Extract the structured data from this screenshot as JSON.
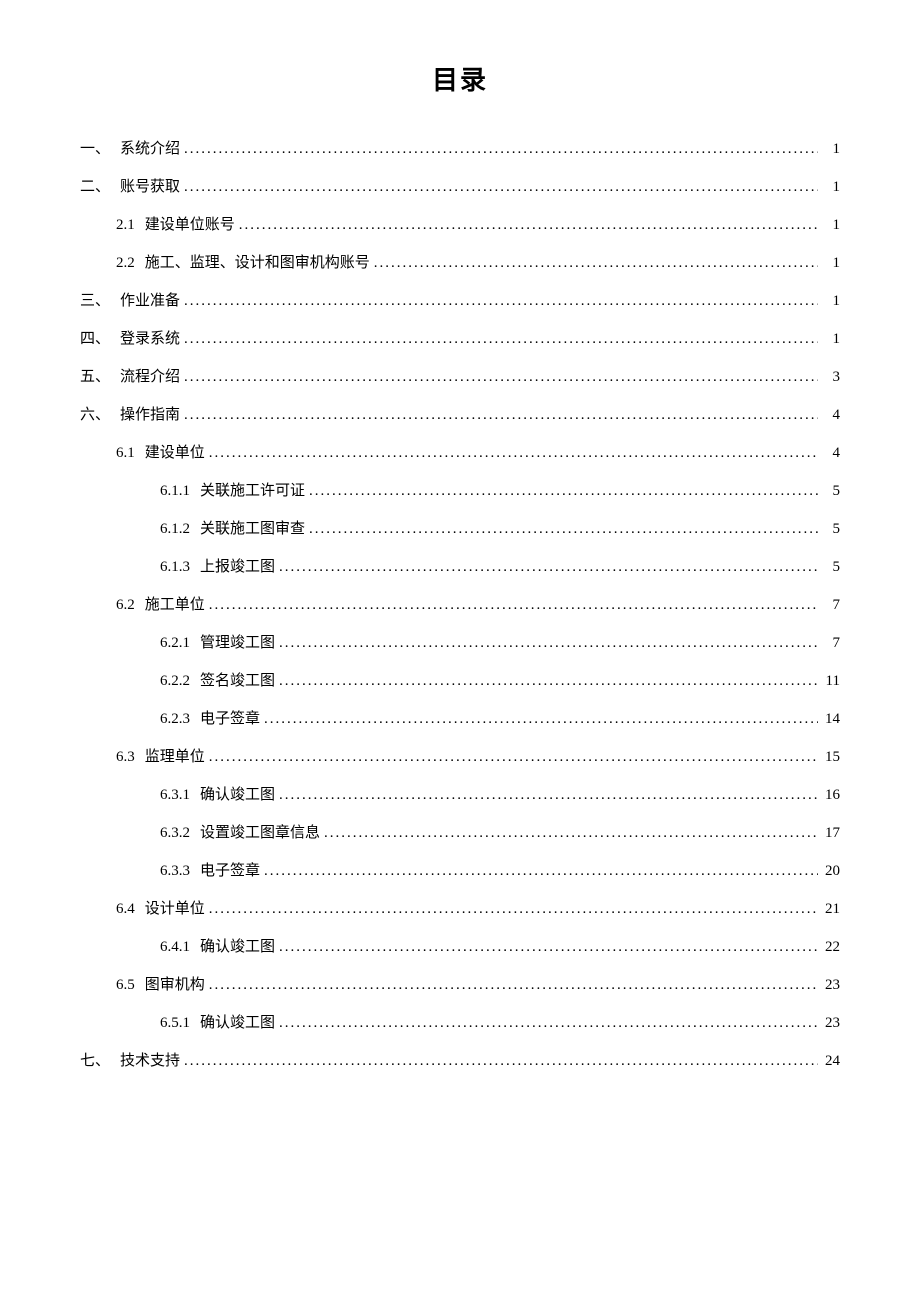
{
  "title": "目录",
  "toc": [
    {
      "level": 0,
      "num": "一、",
      "label": "系统介绍",
      "page": "1"
    },
    {
      "level": 0,
      "num": "二、",
      "label": "账号获取",
      "page": "1"
    },
    {
      "level": 1,
      "num": "2.1",
      "label": "建设单位账号",
      "page": "1"
    },
    {
      "level": 1,
      "num": "2.2",
      "label": "施工、监理、设计和图审机构账号",
      "page": "1"
    },
    {
      "level": 0,
      "num": "三、",
      "label": "作业准备",
      "page": "1"
    },
    {
      "level": 0,
      "num": "四、",
      "label": "登录系统",
      "page": "1"
    },
    {
      "level": 0,
      "num": "五、",
      "label": "流程介绍",
      "page": "3"
    },
    {
      "level": 0,
      "num": "六、",
      "label": "操作指南",
      "page": "4"
    },
    {
      "level": 1,
      "num": "6.1",
      "label": "建设单位",
      "page": "4"
    },
    {
      "level": 2,
      "num": "6.1.1",
      "label": "关联施工许可证",
      "page": "5"
    },
    {
      "level": 2,
      "num": "6.1.2",
      "label": "关联施工图审查",
      "page": "5"
    },
    {
      "level": 2,
      "num": "6.1.3",
      "label": "上报竣工图",
      "page": "5"
    },
    {
      "level": 1,
      "num": "6.2",
      "label": "施工单位",
      "page": "7"
    },
    {
      "level": 2,
      "num": "6.2.1",
      "label": "管理竣工图",
      "page": "7"
    },
    {
      "level": 2,
      "num": "6.2.2",
      "label": "签名竣工图",
      "page": "11"
    },
    {
      "level": 2,
      "num": "6.2.3",
      "label": "电子签章",
      "page": "14"
    },
    {
      "level": 1,
      "num": "6.3",
      "label": "监理单位",
      "page": "15"
    },
    {
      "level": 2,
      "num": "6.3.1",
      "label": "确认竣工图",
      "page": "16"
    },
    {
      "level": 2,
      "num": "6.3.2",
      "label": "设置竣工图章信息",
      "page": "17"
    },
    {
      "level": 2,
      "num": "6.3.3",
      "label": "电子签章",
      "page": "20"
    },
    {
      "level": 1,
      "num": "6.4",
      "label": "设计单位",
      "page": "21"
    },
    {
      "level": 2,
      "num": "6.4.1",
      "label": "确认竣工图",
      "page": "22"
    },
    {
      "level": 1,
      "num": "6.5",
      "label": "图审机构",
      "page": "23"
    },
    {
      "level": 2,
      "num": "6.5.1",
      "label": "确认竣工图",
      "page": "23"
    },
    {
      "level": 0,
      "num": "七、",
      "label": "技术支持",
      "page": "24"
    }
  ]
}
